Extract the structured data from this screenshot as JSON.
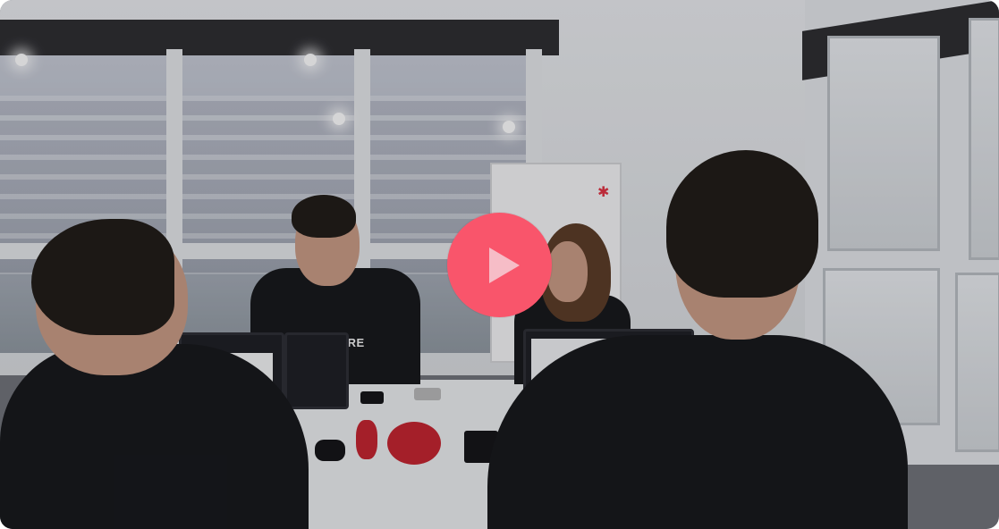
{
  "video": {
    "overlay": {
      "play_button_color": "#f9556b",
      "play_icon": "play-icon"
    },
    "scene": {
      "shirt_text": "ORE"
    }
  }
}
